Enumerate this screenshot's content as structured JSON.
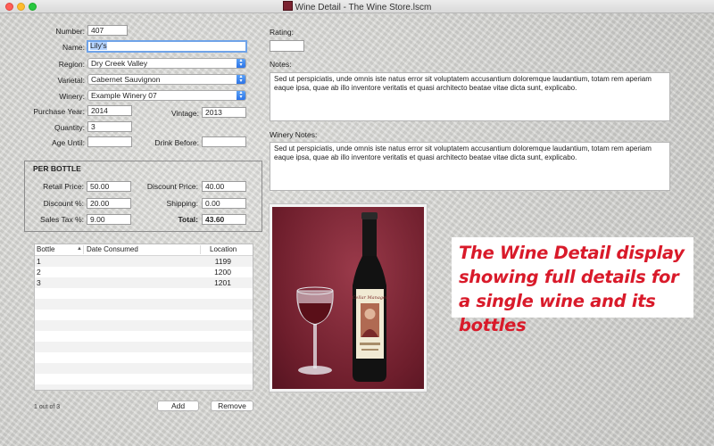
{
  "window": {
    "title": "Wine Detail - The Wine Store.lscm"
  },
  "form": {
    "number": {
      "label": "Number:",
      "value": "407"
    },
    "name": {
      "label": "Name:",
      "value": "Lily's"
    },
    "region": {
      "label": "Region:",
      "value": "Dry Creek Valley"
    },
    "varietal": {
      "label": "Varietal:",
      "value": "Cabernet Sauvignon"
    },
    "winery": {
      "label": "Winery:",
      "value": "Example Winery 07"
    },
    "purchase_year": {
      "label": "Purchase Year:",
      "value": "2014"
    },
    "vintage": {
      "label": "Vintage:",
      "value": "2013"
    },
    "quantity": {
      "label": "Quantity:",
      "value": "3"
    },
    "age_until": {
      "label": "Age Until:",
      "value": ""
    },
    "drink_before": {
      "label": "Drink Before:",
      "value": ""
    }
  },
  "per_bottle": {
    "title": "PER BOTTLE",
    "retail_price": {
      "label": "Retail Price:",
      "value": "50.00"
    },
    "discount_price": {
      "label": "Discount Price:",
      "value": "40.00"
    },
    "discount_pct": {
      "label": "Discount %:",
      "value": "20.00"
    },
    "shipping": {
      "label": "Shipping:",
      "value": "0.00"
    },
    "sales_tax": {
      "label": "Sales Tax %:",
      "value": "9.00"
    },
    "total": {
      "label": "Total:",
      "value": "43.60"
    }
  },
  "bottles": {
    "columns": [
      "Bottle",
      "Date Consumed",
      "Location"
    ],
    "rows": [
      {
        "bottle": "1",
        "date_consumed": "",
        "location": "1199"
      },
      {
        "bottle": "2",
        "date_consumed": "",
        "location": "1200"
      },
      {
        "bottle": "3",
        "date_consumed": "",
        "location": "1201"
      }
    ],
    "count_text": "1 out of 3",
    "add_label": "Add",
    "remove_label": "Remove"
  },
  "rating": {
    "label": "Rating:",
    "value": ""
  },
  "notes": {
    "label": "Notes:",
    "value": "Sed ut perspiciatis, unde omnis iste natus error sit voluptatem accusantium doloremque laudantium, totam rem aperiam eaque ipsa, quae ab illo inventore veritatis et quasi architecto beatae vitae dicta sunt, explicabo."
  },
  "winery_notes": {
    "label": "Winery Notes:",
    "value": "Sed ut perspiciatis, unde omnis iste natus error sit voluptatem accusantium doloremque laudantium, totam rem aperiam eaque ipsa, quae ab illo inventore veritatis et quasi architecto beatae vitae dicta sunt, explicabo."
  },
  "label_art": {
    "line1": "Cellar Manager"
  },
  "caption": {
    "text": "The Wine Detail display showing full details for a single wine and its bottles",
    "color": "#d91a2a"
  }
}
